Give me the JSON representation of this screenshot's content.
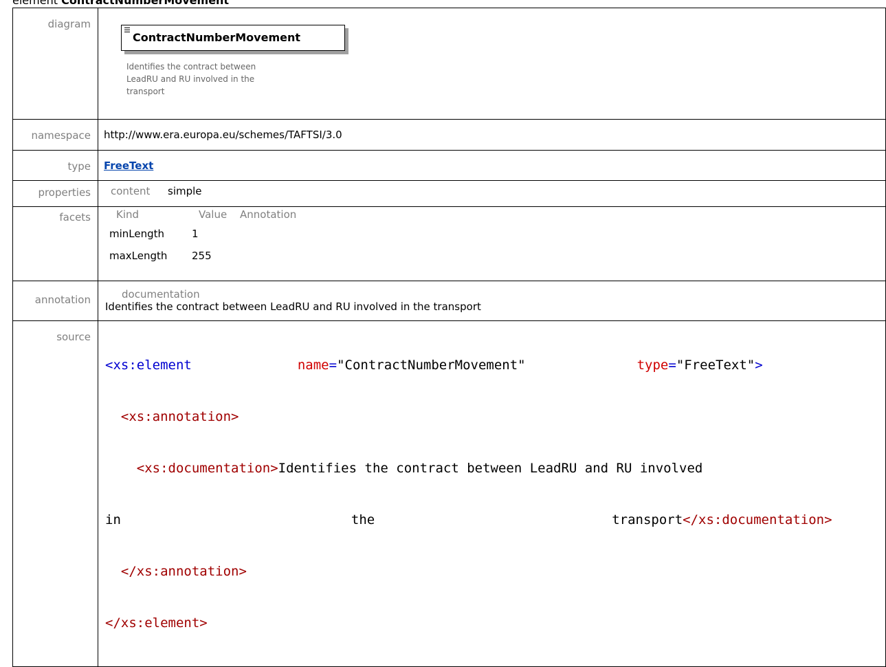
{
  "page": {
    "title_prefix": "element",
    "title_name": "ContractNumberMovement"
  },
  "labels": {
    "diagram": "diagram",
    "namespace": "namespace",
    "type": "type",
    "properties": "properties",
    "facets": "facets",
    "annotation": "annotation",
    "source": "source"
  },
  "diagram": {
    "name": "ContractNumberMovement",
    "description_lines": [
      "Identifies the contract between",
      "LeadRU and RU involved in the",
      "transport"
    ]
  },
  "namespace": {
    "value": "http://www.era.europa.eu/schemes/TAFTSI/3.0"
  },
  "type": {
    "value": "FreeText"
  },
  "properties": {
    "header": "content",
    "value": "simple"
  },
  "facets": {
    "headers": [
      "Kind",
      "Value",
      "Annotation"
    ],
    "rows": [
      {
        "kind": "minLength",
        "value": "1"
      },
      {
        "kind": "maxLength",
        "value": "255"
      }
    ]
  },
  "annotation": {
    "header": "documentation",
    "text": "Identifies the contract between LeadRU and RU involved in the transport"
  },
  "source": {
    "line1_tag": "<xs:element",
    "line1_attr1_name": "name",
    "line1_attr1_value": "\"ContractNumberMovement\"",
    "line1_attr2_name": "type",
    "line1_attr2_value": "\"FreeText\"",
    "line1_close": ">",
    "line2": "<xs:annotation>",
    "line3_open": "<xs:documentation>",
    "line3_text": "Identifies the contract between LeadRU and RU involved",
    "line4_text_a": "in",
    "line4_text_b": "the",
    "line4_text_c": "transport",
    "line4_close": "</xs:documentation>",
    "line5": "</xs:annotation>",
    "line6": "</xs:element>"
  }
}
